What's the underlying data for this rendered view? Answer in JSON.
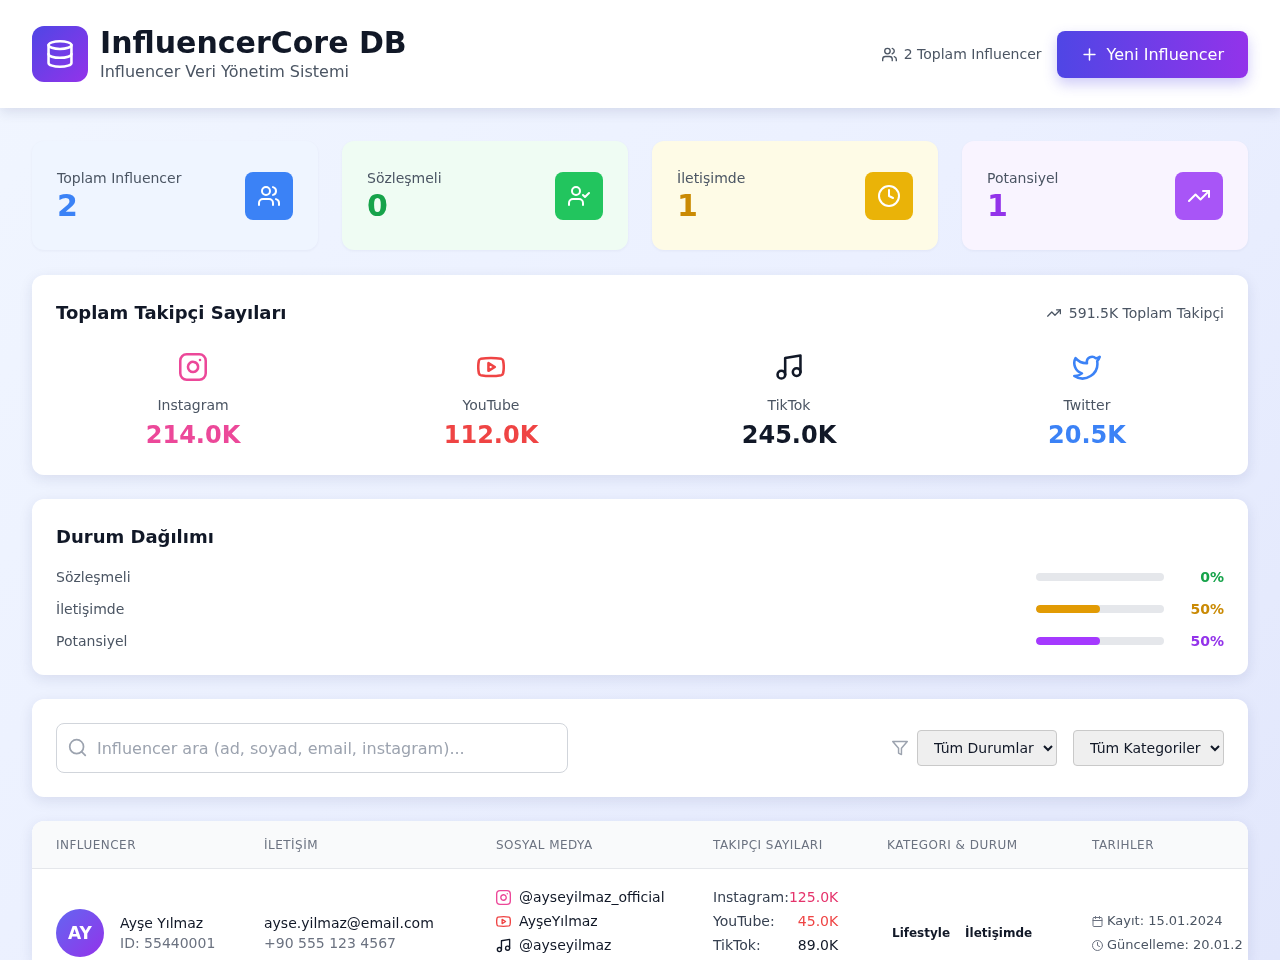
{
  "header": {
    "title": "InfluencerCore DB",
    "subtitle": "Influencer Veri Yönetim Sistemi",
    "count_label": "2 Toplam Influencer",
    "new_button": "Yeni Influencer"
  },
  "stats": [
    {
      "kind": "total",
      "label": "Toplam Influencer",
      "value": "2",
      "color": "#3b82f6"
    },
    {
      "kind": "contracted",
      "label": "Sözleşmeli",
      "value": "0",
      "color": "#16a34a"
    },
    {
      "kind": "contacting",
      "label": "İletişimde",
      "value": "1",
      "color": "#ca8a04"
    },
    {
      "kind": "potential",
      "label": "Potansiyel",
      "value": "1",
      "color": "#9333ea"
    }
  ],
  "followers": {
    "title": "Toplam Takipçi Sayıları",
    "total": "591.5K Toplam Takipçi",
    "platforms": [
      {
        "kind": "instagram",
        "name": "Instagram",
        "value": "214.0K",
        "color": "#ec4899"
      },
      {
        "kind": "youtube",
        "name": "YouTube",
        "value": "112.0K",
        "color": "#ef4444"
      },
      {
        "kind": "tiktok",
        "name": "TikTok",
        "value": "245.0K",
        "color": "#111827"
      },
      {
        "kind": "twitter",
        "name": "Twitter",
        "value": "20.5K",
        "color": "#3b82f6"
      }
    ]
  },
  "status_distribution": {
    "title": "Durum Dağılımı",
    "items": [
      {
        "label": "Sözleşmeli",
        "level": 0,
        "reading": "0%",
        "color": "#16a34a"
      },
      {
        "label": "İletişimde",
        "level": 0.5,
        "reading": "50%",
        "color": "#ca8a04"
      },
      {
        "label": "Potansiyel",
        "level": 0.5,
        "reading": "50%",
        "color": "#9333ea"
      }
    ]
  },
  "filters": {
    "search": {
      "placeholder": "Influencer ara (ad, soyad, email, instagram)..."
    },
    "selects": [
      {
        "value": "Tüm Durumlar"
      },
      {
        "value": "Tüm Kategoriler"
      }
    ]
  },
  "table": {
    "columns": [
      "INFLUENCER",
      "İLETİŞİM",
      "SOSYAL MEDYA",
      "TAKIPÇI SAYILARI",
      "KATEGORI & DURUM",
      "TARIHLER"
    ],
    "rows": [
      {
        "initials": "AY",
        "name": "Ayşe Yılmaz",
        "id": "ID: 55440001",
        "email": "ayse.yilmaz@email.com",
        "phone": "+90 555 123 4567",
        "social": [
          {
            "kind": "instagram",
            "handle": "@ayseyilmaz_official"
          },
          {
            "kind": "youtube",
            "handle": "AyşeYılmaz"
          },
          {
            "kind": "tiktok",
            "handle": "@ayseyilmaz"
          }
        ],
        "followers": [
          {
            "kind": "instagram",
            "label": "Instagram:",
            "value": "125.0K"
          },
          {
            "kind": "youtube",
            "label": "YouTube:",
            "value": "45.0K"
          },
          {
            "kind": "tiktok",
            "label": "TikTok:",
            "value": "89.0K"
          }
        ],
        "category": "Lifestyle",
        "status": "İletişimde",
        "dates": [
          {
            "kind": "registered",
            "text": "Kayıt: 15.01.2024"
          },
          {
            "kind": "updated",
            "text": "Güncelleme: 20.01.2"
          }
        ]
      }
    ]
  }
}
